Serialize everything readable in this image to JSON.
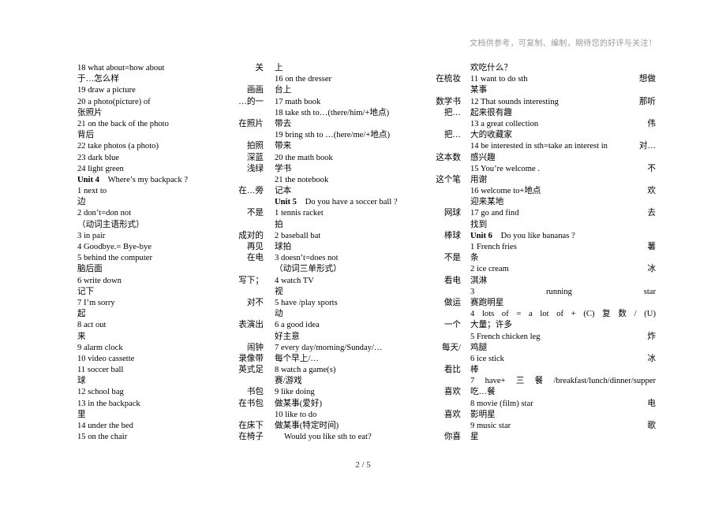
{
  "header_note": "文档供参考，可复制、编制，期待您的好评与关注！",
  "page_number": "2 / 5",
  "columns": [
    {
      "lines": [
        {
          "en": "18 what about=how about",
          "zh": "关"
        },
        {
          "text": "于…怎么样"
        },
        {
          "en": "19 draw a picture",
          "zh": "画画"
        },
        {
          "en": "20 a photo(picture) of",
          "zh": "…的一"
        },
        {
          "text": "张照片"
        },
        {
          "en": "21 on the back of the photo",
          "zh": "在照片"
        },
        {
          "text": "背后"
        },
        {
          "en": "22 take photos (a photo)",
          "zh": "拍照"
        },
        {
          "en": "23 dark blue",
          "zh": "深蓝"
        },
        {
          "en": "24 light green",
          "zh": "浅绿"
        },
        {
          "unit": "Unit 4",
          "title": "Where’s my backpack ?"
        },
        {
          "en": "1 next to",
          "zh": "在…旁"
        },
        {
          "text": "边"
        },
        {
          "en": "2 don’t=don not",
          "zh": "不是"
        },
        {
          "text": "（动词主语形式）"
        },
        {
          "en": "3 in pair",
          "zh": "成对的"
        },
        {
          "en": "4 Goodbye.= Bye-bye",
          "zh": "再见"
        },
        {
          "en": "5 behind the computer",
          "zh": "在电"
        },
        {
          "text": "脑后面"
        },
        {
          "en": "6 write down",
          "zh": "写下；"
        },
        {
          "text": "记下"
        },
        {
          "en": "7 I’m sorry",
          "zh": "对不"
        },
        {
          "text": "起"
        },
        {
          "en": "8 act out",
          "zh": "表演出"
        },
        {
          "text": "来"
        },
        {
          "en": "9 alarm clock",
          "zh": "闹钟"
        },
        {
          "en": "10 video cassette",
          "zh": "录像带"
        },
        {
          "en": "11 soccer ball",
          "zh": "英式足"
        },
        {
          "text": "球"
        },
        {
          "en": "12 school bag",
          "zh": "书包"
        },
        {
          "en": "13 in the backpack",
          "zh": "在书包"
        },
        {
          "text": "里"
        },
        {
          "en": "14 under the bed",
          "zh": "在床下"
        },
        {
          "en": "15 on the chair",
          "zh": "在椅子"
        }
      ]
    },
    {
      "lines": [
        {
          "text": "上"
        },
        {
          "en": "16 on the dresser",
          "zh": "在梳妆"
        },
        {
          "text": "台上"
        },
        {
          "en": "17 math book",
          "zh": "数学书"
        },
        {
          "en": "18 take sth to…(there/him/+地点)",
          "zh": "把…"
        },
        {
          "text": "带去"
        },
        {
          "en": "19 bring sth to …(here/me/+地点)",
          "zh": "把…"
        },
        {
          "text": "带来"
        },
        {
          "en": "20 the math book",
          "zh": "这本数"
        },
        {
          "text": "学书"
        },
        {
          "en": "21 the notebook",
          "zh": "这个笔"
        },
        {
          "text": "记本"
        },
        {
          "unit": "Unit 5",
          "title": "Do you have a soccer ball ?"
        },
        {
          "en": "1 tennis racket",
          "zh": "网球"
        },
        {
          "text": "拍"
        },
        {
          "en": "2 baseball bat",
          "zh": "棒球"
        },
        {
          "text": "球拍"
        },
        {
          "en": "3 doesn’t=does not",
          "zh": "不是"
        },
        {
          "text": "（动词三单形式）"
        },
        {
          "en": "4 watch TV",
          "zh": "看电"
        },
        {
          "text": "视"
        },
        {
          "en": "5 have /play sports",
          "zh": "做运"
        },
        {
          "text": "动"
        },
        {
          "en": "6 a good idea",
          "zh": "一个"
        },
        {
          "text": "好主意"
        },
        {
          "en": "7 every day/morning/Sunday/…",
          "zh": "每天/"
        },
        {
          "text": "每个早上/…"
        },
        {
          "en": "8 watch a game(s)",
          "zh": "看比"
        },
        {
          "text": "赛/游戏"
        },
        {
          "en": "9 like doing",
          "zh": "喜欢"
        },
        {
          "text": "做某事(爱好)"
        },
        {
          "en": "10 like to do",
          "zh": "喜欢"
        },
        {
          "text": "做某事(特定时间)"
        },
        {
          "en": "Would you like sth to eat?",
          "zh": "你喜",
          "indent": true
        }
      ]
    },
    {
      "lines": [
        {
          "text": "欢吃什么？"
        },
        {
          "en": "11 want to do sth",
          "zh": "想做"
        },
        {
          "text": "某事"
        },
        {
          "en": "12 That sounds interesting",
          "zh": "那听"
        },
        {
          "text": "起来很有趣"
        },
        {
          "en": "13 a great collection",
          "zh": "伟"
        },
        {
          "text": "大的收藏家"
        },
        {
          "en": "14 be interested in sth=take an interest in",
          "zh": "对…"
        },
        {
          "text": "感兴趣"
        },
        {
          "en": "15 You’re welcome .",
          "zh": "不"
        },
        {
          "text": "用谢"
        },
        {
          "en": "16 welcome to+地点",
          "zh": "欢"
        },
        {
          "text": "迎来某地"
        },
        {
          "en": "17 go and find",
          "zh": "去"
        },
        {
          "text": "找到"
        },
        {
          "unit": "Unit 6",
          "title": "Do you like bananas ?"
        },
        {
          "en": "1 French fries",
          "zh": "薯"
        },
        {
          "text": "条"
        },
        {
          "en": "2 ice cream",
          "zh": "冰"
        },
        {
          "text": "淇淋"
        },
        {
          "justified": [
            "3",
            "running",
            "star"
          ]
        },
        {
          "text": "赛跑明星"
        },
        {
          "justified": [
            "4",
            "lots",
            "of",
            "=",
            "a",
            "lot",
            "of",
            "+",
            "(C)",
            "复",
            "数",
            "/",
            "(U)"
          ]
        },
        {
          "text": "大量；许多"
        },
        {
          "en": "5 French chicken leg",
          "zh": "炸"
        },
        {
          "text": "鸡腿"
        },
        {
          "en": "6 ice stick",
          "zh": "冰"
        },
        {
          "text": "棒"
        },
        {
          "justified": [
            "7",
            "have+",
            "三",
            "餐",
            "/breakfast/lunch/dinner/supper"
          ]
        },
        {
          "text": "吃…餐"
        },
        {
          "en": "8 movie (film) star",
          "zh": "电"
        },
        {
          "text": "影明星"
        },
        {
          "en": "9 music star",
          "zh": "歌"
        },
        {
          "text": "星"
        }
      ]
    }
  ]
}
